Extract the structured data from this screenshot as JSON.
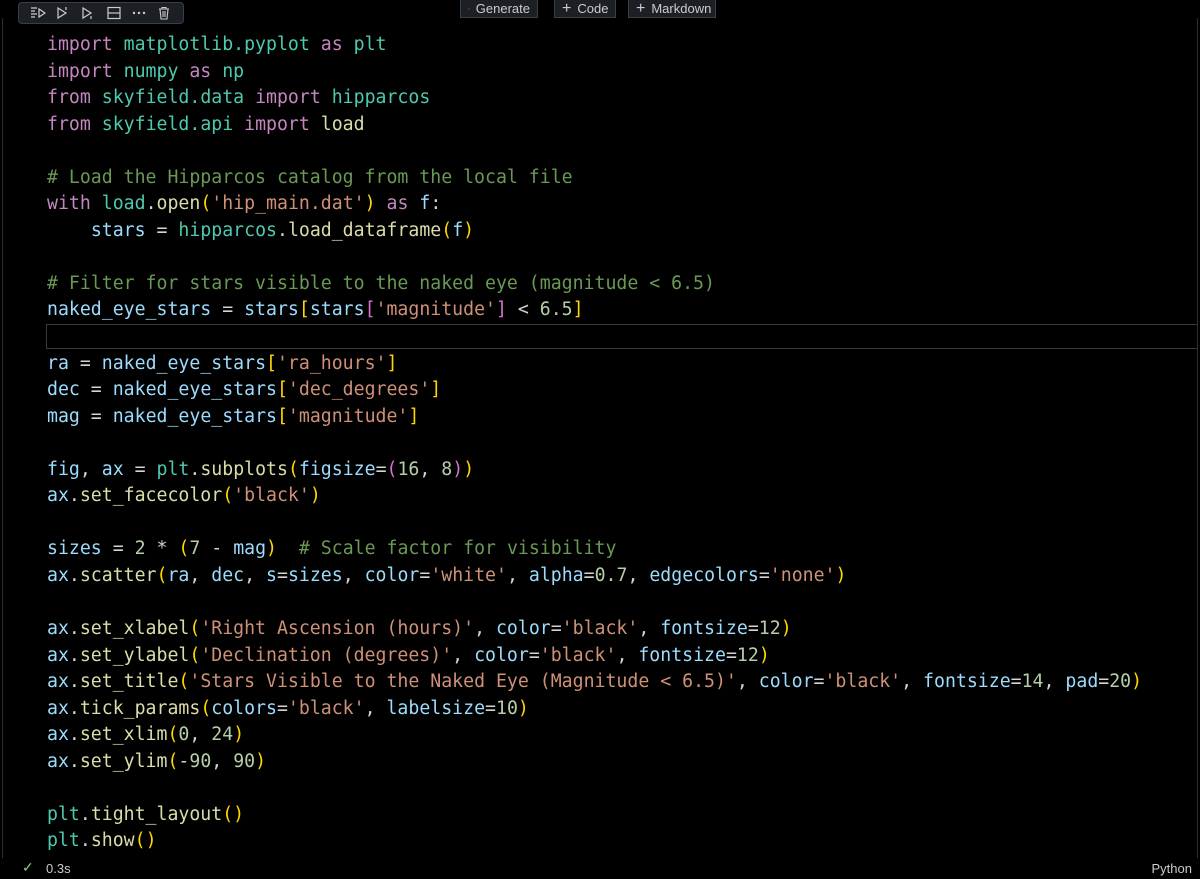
{
  "toolbar": {
    "icons": [
      "run-by-line-icon",
      "execute-above-icon",
      "execute-below-icon",
      "split-cell-icon",
      "more-icon",
      "delete-icon"
    ]
  },
  "insert": {
    "generate_label": "Generate",
    "code_label": "Code",
    "markdown_label": "Markdown"
  },
  "code_lines": [
    [
      [
        "kw",
        "import"
      ],
      [
        "op",
        " "
      ],
      [
        "mod",
        "matplotlib.pyplot"
      ],
      [
        "op",
        " "
      ],
      [
        "kw",
        "as"
      ],
      [
        "op",
        " "
      ],
      [
        "mod",
        "plt"
      ]
    ],
    [
      [
        "kw",
        "import"
      ],
      [
        "op",
        " "
      ],
      [
        "mod",
        "numpy"
      ],
      [
        "op",
        " "
      ],
      [
        "kw",
        "as"
      ],
      [
        "op",
        " "
      ],
      [
        "mod",
        "np"
      ]
    ],
    [
      [
        "kw",
        "from"
      ],
      [
        "op",
        " "
      ],
      [
        "mod",
        "skyfield.data"
      ],
      [
        "op",
        " "
      ],
      [
        "kw",
        "import"
      ],
      [
        "op",
        " "
      ],
      [
        "mod",
        "hipparcos"
      ]
    ],
    [
      [
        "kw",
        "from"
      ],
      [
        "op",
        " "
      ],
      [
        "mod",
        "skyfield.api"
      ],
      [
        "op",
        " "
      ],
      [
        "kw",
        "import"
      ],
      [
        "op",
        " "
      ],
      [
        "fn",
        "load"
      ]
    ],
    [],
    [
      [
        "com",
        "# Load the Hipparcos catalog from the local file"
      ]
    ],
    [
      [
        "kw",
        "with"
      ],
      [
        "op",
        " "
      ],
      [
        "mod",
        "load"
      ],
      [
        "op",
        "."
      ],
      [
        "fn",
        "open"
      ],
      [
        "p1",
        "("
      ],
      [
        "str",
        "'hip_main.dat'"
      ],
      [
        "p1",
        ")"
      ],
      [
        "op",
        " "
      ],
      [
        "kw",
        "as"
      ],
      [
        "op",
        " "
      ],
      [
        "var",
        "f"
      ],
      [
        "op",
        ":"
      ]
    ],
    [
      [
        "op",
        "    "
      ],
      [
        "var",
        "stars"
      ],
      [
        "op",
        " = "
      ],
      [
        "mod",
        "hipparcos"
      ],
      [
        "op",
        "."
      ],
      [
        "fn",
        "load_dataframe"
      ],
      [
        "p1",
        "("
      ],
      [
        "var",
        "f"
      ],
      [
        "p1",
        ")"
      ]
    ],
    [],
    [
      [
        "com",
        "# Filter for stars visible to the naked eye (magnitude < 6.5)"
      ]
    ],
    [
      [
        "var",
        "naked_eye_stars"
      ],
      [
        "op",
        " = "
      ],
      [
        "var",
        "stars"
      ],
      [
        "p1",
        "["
      ],
      [
        "var",
        "stars"
      ],
      [
        "p2",
        "["
      ],
      [
        "str",
        "'magnitude'"
      ],
      [
        "p2",
        "]"
      ],
      [
        "op",
        " < "
      ],
      [
        "num",
        "6.5"
      ],
      [
        "p1",
        "]"
      ]
    ],
    [],
    [
      [
        "var",
        "ra"
      ],
      [
        "op",
        " = "
      ],
      [
        "var",
        "naked_eye_stars"
      ],
      [
        "p1",
        "["
      ],
      [
        "str",
        "'ra_hours'"
      ],
      [
        "p1",
        "]"
      ]
    ],
    [
      [
        "var",
        "dec"
      ],
      [
        "op",
        " = "
      ],
      [
        "var",
        "naked_eye_stars"
      ],
      [
        "p1",
        "["
      ],
      [
        "str",
        "'dec_degrees'"
      ],
      [
        "p1",
        "]"
      ]
    ],
    [
      [
        "var",
        "mag"
      ],
      [
        "op",
        " = "
      ],
      [
        "var",
        "naked_eye_stars"
      ],
      [
        "p1",
        "["
      ],
      [
        "str",
        "'magnitude'"
      ],
      [
        "p1",
        "]"
      ]
    ],
    [],
    [
      [
        "var",
        "fig"
      ],
      [
        "op",
        ", "
      ],
      [
        "var",
        "ax"
      ],
      [
        "op",
        " = "
      ],
      [
        "mod",
        "plt"
      ],
      [
        "op",
        "."
      ],
      [
        "fn",
        "subplots"
      ],
      [
        "p1",
        "("
      ],
      [
        "var",
        "figsize"
      ],
      [
        "op",
        "="
      ],
      [
        "p2",
        "("
      ],
      [
        "num",
        "16"
      ],
      [
        "op",
        ", "
      ],
      [
        "num",
        "8"
      ],
      [
        "p2",
        ")"
      ],
      [
        "p1",
        ")"
      ]
    ],
    [
      [
        "var",
        "ax"
      ],
      [
        "op",
        "."
      ],
      [
        "fn",
        "set_facecolor"
      ],
      [
        "p1",
        "("
      ],
      [
        "str",
        "'black'"
      ],
      [
        "p1",
        ")"
      ]
    ],
    [],
    [
      [
        "var",
        "sizes"
      ],
      [
        "op",
        " = "
      ],
      [
        "num",
        "2"
      ],
      [
        "op",
        " * "
      ],
      [
        "p1",
        "("
      ],
      [
        "num",
        "7"
      ],
      [
        "op",
        " - "
      ],
      [
        "var",
        "mag"
      ],
      [
        "p1",
        ")"
      ],
      [
        "op",
        "  "
      ],
      [
        "com",
        "# Scale factor for visibility"
      ]
    ],
    [
      [
        "var",
        "ax"
      ],
      [
        "op",
        "."
      ],
      [
        "fn",
        "scatter"
      ],
      [
        "p1",
        "("
      ],
      [
        "var",
        "ra"
      ],
      [
        "op",
        ", "
      ],
      [
        "var",
        "dec"
      ],
      [
        "op",
        ", "
      ],
      [
        "var",
        "s"
      ],
      [
        "op",
        "="
      ],
      [
        "var",
        "sizes"
      ],
      [
        "op",
        ", "
      ],
      [
        "var",
        "color"
      ],
      [
        "op",
        "="
      ],
      [
        "str",
        "'white'"
      ],
      [
        "op",
        ", "
      ],
      [
        "var",
        "alpha"
      ],
      [
        "op",
        "="
      ],
      [
        "num",
        "0.7"
      ],
      [
        "op",
        ", "
      ],
      [
        "var",
        "edgecolors"
      ],
      [
        "op",
        "="
      ],
      [
        "str",
        "'none'"
      ],
      [
        "p1",
        ")"
      ]
    ],
    [],
    [
      [
        "var",
        "ax"
      ],
      [
        "op",
        "."
      ],
      [
        "fn",
        "set_xlabel"
      ],
      [
        "p1",
        "("
      ],
      [
        "str",
        "'Right Ascension (hours)'"
      ],
      [
        "op",
        ", "
      ],
      [
        "var",
        "color"
      ],
      [
        "op",
        "="
      ],
      [
        "str",
        "'black'"
      ],
      [
        "op",
        ", "
      ],
      [
        "var",
        "fontsize"
      ],
      [
        "op",
        "="
      ],
      [
        "num",
        "12"
      ],
      [
        "p1",
        ")"
      ]
    ],
    [
      [
        "var",
        "ax"
      ],
      [
        "op",
        "."
      ],
      [
        "fn",
        "set_ylabel"
      ],
      [
        "p1",
        "("
      ],
      [
        "str",
        "'Declination (degrees)'"
      ],
      [
        "op",
        ", "
      ],
      [
        "var",
        "color"
      ],
      [
        "op",
        "="
      ],
      [
        "str",
        "'black'"
      ],
      [
        "op",
        ", "
      ],
      [
        "var",
        "fontsize"
      ],
      [
        "op",
        "="
      ],
      [
        "num",
        "12"
      ],
      [
        "p1",
        ")"
      ]
    ],
    [
      [
        "var",
        "ax"
      ],
      [
        "op",
        "."
      ],
      [
        "fn",
        "set_title"
      ],
      [
        "p1",
        "("
      ],
      [
        "str",
        "'Stars Visible to the Naked Eye (Magnitude < 6.5)'"
      ],
      [
        "op",
        ", "
      ],
      [
        "var",
        "color"
      ],
      [
        "op",
        "="
      ],
      [
        "str",
        "'black'"
      ],
      [
        "op",
        ", "
      ],
      [
        "var",
        "fontsize"
      ],
      [
        "op",
        "="
      ],
      [
        "num",
        "14"
      ],
      [
        "op",
        ", "
      ],
      [
        "var",
        "pad"
      ],
      [
        "op",
        "="
      ],
      [
        "num",
        "20"
      ],
      [
        "p1",
        ")"
      ]
    ],
    [
      [
        "var",
        "ax"
      ],
      [
        "op",
        "."
      ],
      [
        "fn",
        "tick_params"
      ],
      [
        "p1",
        "("
      ],
      [
        "var",
        "colors"
      ],
      [
        "op",
        "="
      ],
      [
        "str",
        "'black'"
      ],
      [
        "op",
        ", "
      ],
      [
        "var",
        "labelsize"
      ],
      [
        "op",
        "="
      ],
      [
        "num",
        "10"
      ],
      [
        "p1",
        ")"
      ]
    ],
    [
      [
        "var",
        "ax"
      ],
      [
        "op",
        "."
      ],
      [
        "fn",
        "set_xlim"
      ],
      [
        "p1",
        "("
      ],
      [
        "num",
        "0"
      ],
      [
        "op",
        ", "
      ],
      [
        "num",
        "24"
      ],
      [
        "p1",
        ")"
      ]
    ],
    [
      [
        "var",
        "ax"
      ],
      [
        "op",
        "."
      ],
      [
        "fn",
        "set_ylim"
      ],
      [
        "p1",
        "("
      ],
      [
        "op",
        "-"
      ],
      [
        "num",
        "90"
      ],
      [
        "op",
        ", "
      ],
      [
        "num",
        "90"
      ],
      [
        "p1",
        ")"
      ]
    ],
    [],
    [
      [
        "mod",
        "plt"
      ],
      [
        "op",
        "."
      ],
      [
        "fn",
        "tight_layout"
      ],
      [
        "p1",
        "()"
      ]
    ],
    [
      [
        "mod",
        "plt"
      ],
      [
        "op",
        "."
      ],
      [
        "fn",
        "show"
      ],
      [
        "p1",
        "()"
      ]
    ]
  ],
  "status": {
    "check_glyph": "✓",
    "exec_time": "0.3s",
    "language": "Python"
  },
  "colors": {
    "background": "#000000",
    "keyword": "#c586c0",
    "module": "#4ec9b0",
    "variable": "#9cdcfe",
    "function": "#dcdcaa",
    "string": "#ce9178",
    "number": "#b5cea8",
    "comment": "#6a9955",
    "success": "#89d185"
  }
}
